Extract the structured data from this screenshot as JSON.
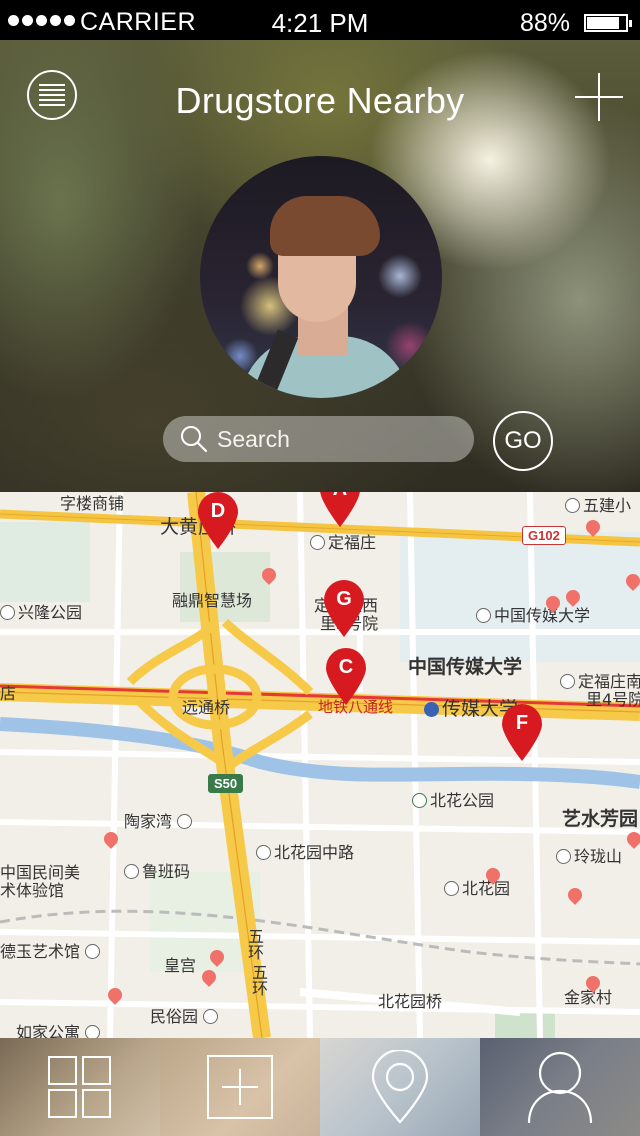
{
  "status_bar": {
    "carrier": "CARRIER",
    "time": "4:21 PM",
    "battery": "88%",
    "battery_level": 0.88
  },
  "header": {
    "title": "Drugstore Nearby",
    "menu_icon": "menu-icon",
    "add_icon": "plus-icon"
  },
  "search": {
    "placeholder": "Search",
    "go_label": "GO"
  },
  "map": {
    "labels": {
      "zilou": "字楼商铺",
      "wujian": "五建小",
      "dahuang": "大黄庄桥",
      "dingfu": "定福庄",
      "g102": "G102",
      "rongding": "融鼎智慧场",
      "dingfu_west": "定福庄西",
      "li2": "里2号院",
      "xingfu": "兴隆公园",
      "cuc_small": "中国传媒大学",
      "cuc_big": "中国传媒大学",
      "dian": "店",
      "dingfu_li4": "定福庄南",
      "li4": "里4号院",
      "yuantong": "远通桥",
      "subway": "地铁八通线",
      "chuanmei": "传媒大学",
      "s50": "S50",
      "beihua_park": "北花公园",
      "yishu": "艺水芳园",
      "taojia": "陶家湾",
      "beihua_mid": "北花园中路",
      "linglong": "玲珑山",
      "museum1": "中国民间美",
      "museum2": "术体验馆",
      "luban": "鲁班码",
      "beihua_yuan": "北花园",
      "deyu": "德玉艺术馆",
      "huanggong": "皇宫",
      "wuhuan": "五环",
      "wuhuan2": "五环",
      "beihua_pic": "北花园桥",
      "jinjia": "金家村",
      "minsu": "民俗园",
      "rujia": "如家公寓"
    },
    "markers": [
      "A",
      "D",
      "G",
      "C",
      "F"
    ],
    "marker_color": "#d71920"
  },
  "tabs": [
    {
      "name": "grid-icon"
    },
    {
      "name": "add-icon"
    },
    {
      "name": "location-pin-icon"
    },
    {
      "name": "user-icon"
    }
  ]
}
